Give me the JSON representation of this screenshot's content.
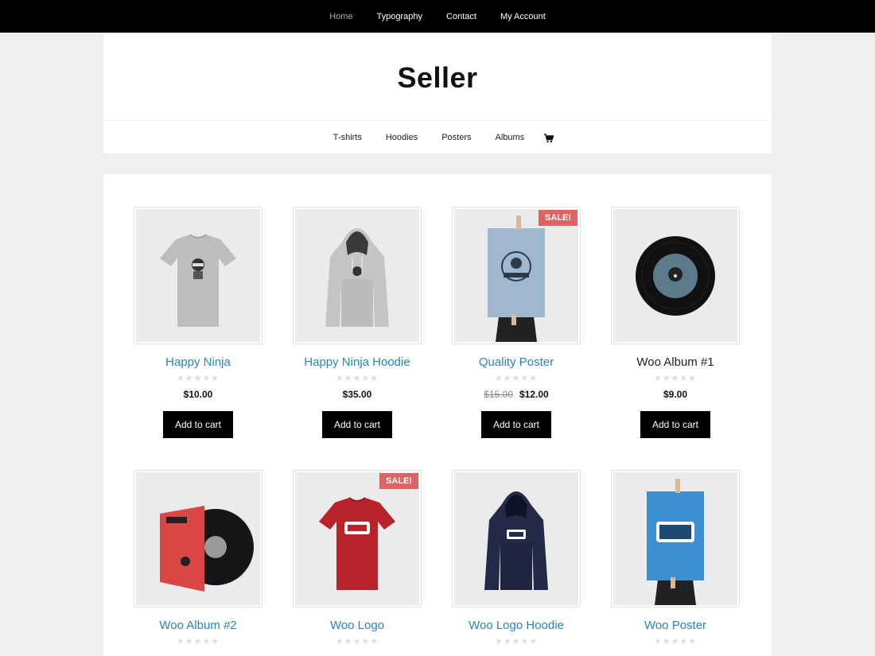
{
  "top_nav": [
    "Home",
    "Typography",
    "Contact",
    "My Account"
  ],
  "site_title": "Seller",
  "category_nav": [
    "T-shirts",
    "Hoodies",
    "Posters",
    "Albums"
  ],
  "stars": "★★★★★",
  "sale_label": "SALE!",
  "add_to_cart": "Add to cart",
  "products": [
    {
      "name": "Happy Ninja",
      "price": "$10.00",
      "old_price": null,
      "sale": false,
      "image": "gray-tshirt-ninja",
      "link_style": "blue"
    },
    {
      "name": "Happy Ninja Hoodie",
      "price": "$35.00",
      "old_price": null,
      "sale": false,
      "image": "gray-hoodie-ninja",
      "link_style": "blue"
    },
    {
      "name": "Quality Poster",
      "price": "$12.00",
      "old_price": "$15.00",
      "sale": true,
      "image": "woothemes-poster",
      "link_style": "blue"
    },
    {
      "name": "Woo Album #1",
      "price": "$9.00",
      "old_price": null,
      "sale": false,
      "image": "vinyl-record",
      "link_style": "dark"
    },
    {
      "name": "Woo Album #2",
      "sale": true,
      "image": "red-album-sleeve",
      "link_style": "blue"
    },
    {
      "name": "Woo Logo",
      "sale": true,
      "image": "red-woo-tshirt",
      "link_style": "blue"
    },
    {
      "name": "Woo Logo Hoodie",
      "sale": false,
      "image": "navy-woo-hoodie",
      "link_style": "blue"
    },
    {
      "name": "Woo Poster",
      "sale": false,
      "image": "blue-woo-poster",
      "link_style": "blue"
    }
  ],
  "colors": {
    "accent_link": "#2a82c4",
    "sale_badge": "#e06363",
    "topbar": "#000000"
  }
}
